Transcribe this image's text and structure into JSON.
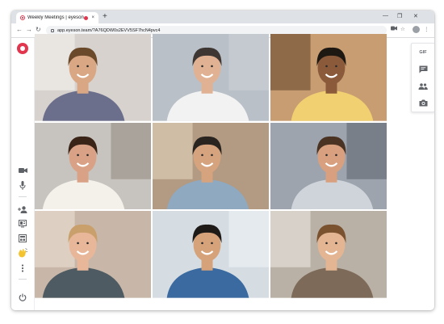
{
  "browser": {
    "tab_title": "Weekly Meetings | eyeson",
    "tab_close": "×",
    "new_tab": "+",
    "window_controls": [
      "—",
      "❐",
      "✕"
    ],
    "url": "app.eyeson.team/?A76QDW0s2EVV5SF7hcN4pvc4",
    "nav": {
      "back": "←",
      "forward": "→",
      "reload": "↻"
    },
    "omnibox_icons": [
      "☆",
      "⋮"
    ]
  },
  "sidebar": {
    "icons": [
      "logo-icon",
      "camera-icon",
      "microphone-icon",
      "add-person-icon",
      "presentation-icon",
      "layout-icon",
      "sticker-icon",
      "more-icon",
      "power-icon"
    ]
  },
  "right_panel": {
    "gif_label": "GIF",
    "icons": [
      "chat-icon",
      "participants-icon",
      "snapshot-icon"
    ]
  },
  "participants": [
    {
      "id": "p1",
      "bg": "#d7d2ce",
      "wall": "#efece8",
      "skin": "#d9a784",
      "hair": "#6b4a2c",
      "shirt": "#6b6f8c"
    },
    {
      "id": "p2",
      "bg": "#b9c0c8",
      "wall": "#c9ced4",
      "skin": "#e0b293",
      "hair": "#3e3632",
      "shirt": "#f2f2f2"
    },
    {
      "id": "p3",
      "bg": "#c89d72",
      "wall": "#7b5a3c",
      "skin": "#8a5a3b",
      "hair": "#1e1812",
      "shirt": "#f0d070"
    },
    {
      "id": "p4",
      "bg": "#c7c4bf",
      "wall": "#a09890",
      "skin": "#d9a286",
      "hair": "#3a2418",
      "shirt": "#f4f0ea"
    },
    {
      "id": "p5",
      "bg": "#b39a82",
      "wall": "#d9c8b0",
      "skin": "#d6a37f",
      "hair": "#2a2420",
      "shirt": "#8ea9c0"
    },
    {
      "id": "p6",
      "bg": "#9da4ad",
      "wall": "#6c737c",
      "skin": "#d8a07e",
      "hair": "#4a3322",
      "shirt": "#cfd4db"
    },
    {
      "id": "p7",
      "bg": "#c8b7a8",
      "wall": "#e4d8cc",
      "skin": "#e8b799",
      "hair": "#c9a06c",
      "shirt": "#4e5b62"
    },
    {
      "id": "p8",
      "bg": "#d5dde3",
      "wall": "#e8edf1",
      "skin": "#d6a27a",
      "hair": "#1d1a18",
      "shirt": "#3a6aa0"
    },
    {
      "id": "p9",
      "bg": "#b9b1a6",
      "wall": "#e1dcd4",
      "skin": "#e3b592",
      "hair": "#7a5230",
      "shirt": "#7d6a58"
    }
  ],
  "colors": {
    "accent": "#e2364f",
    "icon": "#5f6368",
    "sticker": "#f4c430"
  }
}
